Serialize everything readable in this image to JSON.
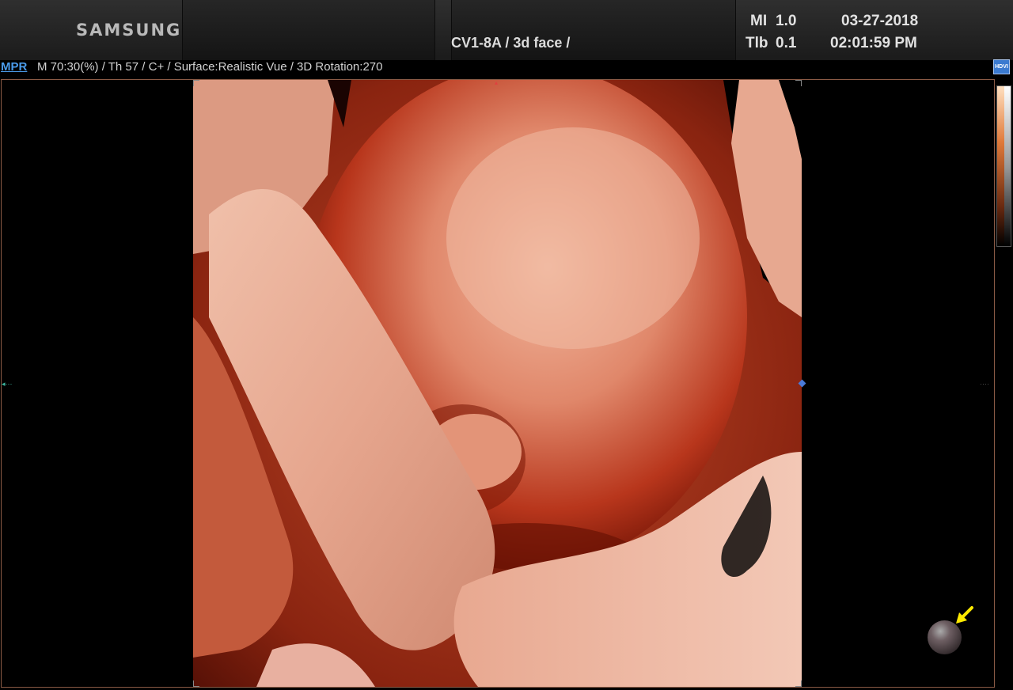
{
  "header": {
    "brand": "SAMSUNG",
    "probe_preset": "CV1-8A / 3d face /",
    "mi_label": "MI",
    "mi_value": "1.0",
    "tib_label": "Tlb",
    "tib_value": "0.1",
    "date": "03-27-2018",
    "time": "02:01:59 PM"
  },
  "infobar": {
    "mode_link": "MPR",
    "parameters": "M 70:30(%) / Th 57 / C+ / Surface:Realistic Vue / 3D Rotation:270"
  },
  "badge": {
    "label": "HDVI"
  },
  "colors": {
    "mode_link": "#4a9bea",
    "viewport_border": "#8a5a45",
    "pointer_arrow": "#ffea00"
  },
  "icons": {
    "orientation": "sphere-icon",
    "pointer": "arrow-icon"
  }
}
